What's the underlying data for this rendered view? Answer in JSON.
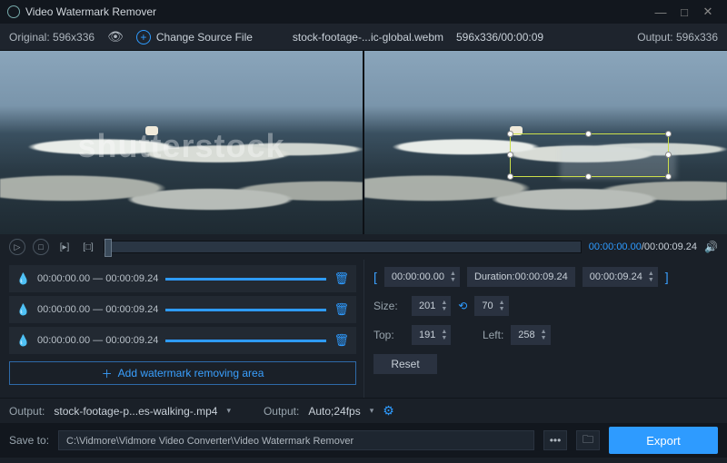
{
  "titlebar": {
    "title": "Video Watermark Remover"
  },
  "topbar": {
    "original_label": "Original:",
    "original_dim": "596x336",
    "change_source": "Change Source File",
    "filename": "stock-footage-...ic-global.webm",
    "fileinfo": "596x336/00:00:09",
    "output_label": "Output:",
    "output_dim": "596x336"
  },
  "watermark_text": "shutterstock",
  "playback": {
    "current": "00:00:00.00",
    "total": "00:00:09.24"
  },
  "areas": [
    {
      "start": "00:00:00.00",
      "end": "00:00:09.24"
    },
    {
      "start": "00:00:00.00",
      "end": "00:00:09.24"
    },
    {
      "start": "00:00:00.00",
      "end": "00:00:09.24"
    }
  ],
  "add_label": "Add watermark removing area",
  "timing": {
    "start": "00:00:00.00",
    "duration_label": "Duration:",
    "duration": "00:00:09.24",
    "end": "00:00:09.24"
  },
  "size": {
    "label": "Size:",
    "w": "201",
    "h": "70"
  },
  "pos": {
    "top_label": "Top:",
    "top": "191",
    "left_label": "Left:",
    "left": "258"
  },
  "reset": "Reset",
  "output": {
    "label1": "Output:",
    "filename": "stock-footage-p...es-walking-.mp4",
    "label2": "Output:",
    "format": "Auto;24fps"
  },
  "save": {
    "label": "Save to:",
    "path": "C:\\Vidmore\\Vidmore Video Converter\\Video Watermark Remover"
  },
  "export": "Export"
}
